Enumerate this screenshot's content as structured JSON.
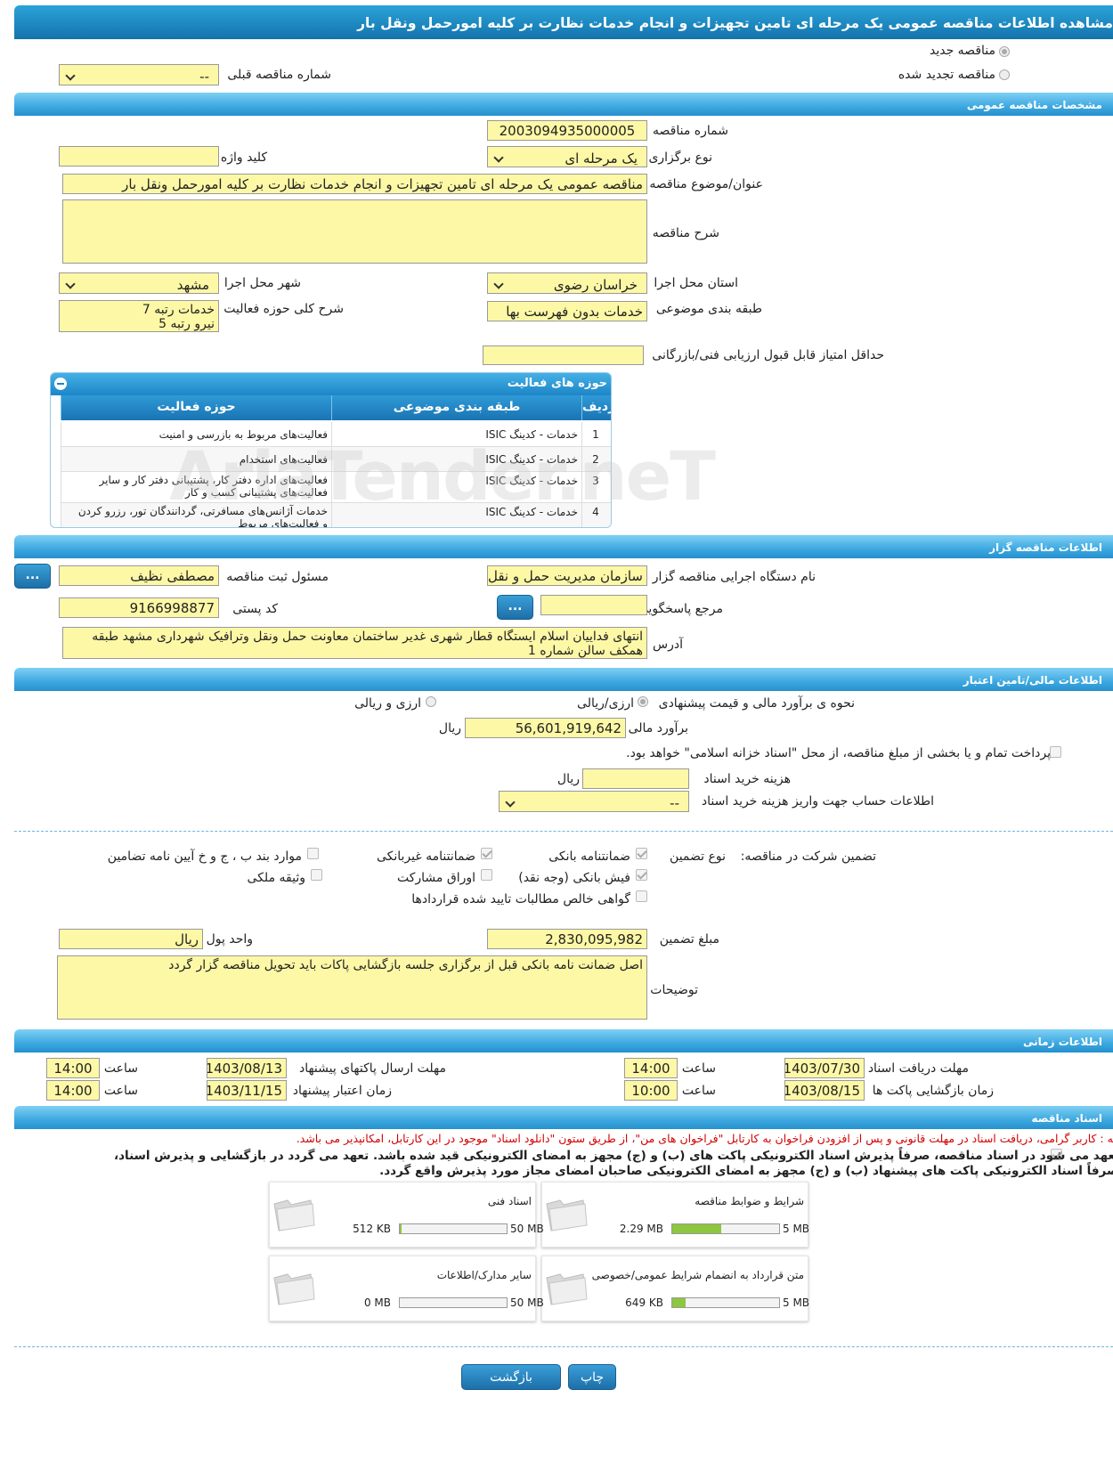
{
  "title": "مشاهده اطلاعات مناقصه عمومی یک مرحله ای تامین تجهیزات و انجام خدمات نظارت بر کلیه امورحمل ونقل بار",
  "top": {
    "new_tender": "مناقصه جدید",
    "renewed_tender": "مناقصه تجدید شده",
    "prev_number_label": "شماره مناقصه قبلی",
    "prev_number_value": "--"
  },
  "sections": {
    "general": "مشخصات مناقصه عمومی",
    "organizer": "اطلاعات مناقصه گزار",
    "financial": "اطلاعات مالی/تامین اعتبار",
    "time": "اطلاعات زمانی",
    "docs": "اسناد مناقصه"
  },
  "general": {
    "number_label": "شماره مناقصه",
    "number_value": "2003094935000005",
    "type_label": "نوع برگزاری",
    "type_value": "یک مرحله ای",
    "keyword_label": "کلید واژه",
    "keyword_value": "",
    "subject_label": "عنوان/موضوع مناقصه",
    "subject_value": "مناقصه عمومی یک مرحله ای تامین تجهیزات و انجام خدمات نظارت بر کلیه امورحمل ونقل بار",
    "desc_label": "شرح مناقصه",
    "desc_value": "",
    "province_label": "استان محل اجرا",
    "province_value": "خراسان رضوی",
    "city_label": "شهر محل اجرا",
    "city_value": "مشهد",
    "category_label": "طبقه بندی موضوعی",
    "category_value": "خدمات بدون فهرست بها",
    "scope_label": "شرح کلی حوزه فعالیت",
    "scope_line1": "خدمات رتبه 7",
    "scope_line2": "نیرو رتبه 5",
    "min_score_label": "حداقل امتیاز قابل قبول ارزیابی فنی/بازرگانی",
    "min_score_value": ""
  },
  "activities": {
    "title": "حوزه های فعالیت",
    "headers": [
      "ردیف",
      "طبقه بندی موضوعی",
      "حوزه فعالیت"
    ],
    "rows": [
      {
        "n": "1",
        "cat": "خدمات - کدینگ ISIC",
        "a1": "فعالیت‌های مربوط به بازرسی و امنیت",
        "a2": ""
      },
      {
        "n": "2",
        "cat": "خدمات - کدینگ ISIC",
        "a1": "فعالیت‌های استخدام",
        "a2": ""
      },
      {
        "n": "3",
        "cat": "خدمات - کدینگ ISIC",
        "a1": "فعالیت‌های  اداره دفتر کار، پشتیبانی دفتر کار و سایر",
        "a2": "فعالیت‌های پشتیبانی کسب و کار"
      },
      {
        "n": "4",
        "cat": "خدمات - کدینگ ISIC",
        "a1": "خدمات آژانس‌های مسافرتی، گردانندگان تور، رزرو کردن",
        "a2": "و فعالیت‌های مربوط"
      }
    ]
  },
  "watermark": "AriaTender.neT",
  "organizer": {
    "org_label": "نام دستگاه اجرایی مناقصه گزار",
    "org_value": "سازمان مدیریت حمل و نقل",
    "resp_label": "مسئول ثبت مناقصه",
    "resp_value": "مصطفی نظیف",
    "ref_label": "مرجع پاسخگویی",
    "ref_value": "",
    "postal_label": "کد پستی",
    "postal_value": "9166998877",
    "addr_label": "آدرس",
    "addr_line1": "انتهای فداییان اسلام ایستگاه قطار شهری غدیر ساختمان معاونت حمل ونقل وترافیک شهرداری مشهد طبقه",
    "addr_line2": "همکف سالن شماره 1",
    "dots": "..."
  },
  "financial": {
    "method_label": "نحوه ی برآورد مالی و قیمت پیشنهادی",
    "opt_rial": "ارزی/ریالی",
    "opt_fx": "ارزی و ریالی",
    "estimate_label": "برآورد مالی",
    "estimate_value": "56,601,919,642",
    "rial": "ریال",
    "treasury_text": "پرداخت تمام و یا بخشی از مبلغ مناقصه، از محل \"اسناد خزانه اسلامی\" خواهد بود.",
    "doc_cost_label": "هزینه خرید اسناد",
    "doc_cost_value": "",
    "account_label": "اطلاعات حساب جهت واریز هزینه خرید اسناد",
    "account_value": "--"
  },
  "guarantee": {
    "label": "تضمین شرکت در مناقصه:",
    "type_label": "نوع تضمین",
    "bank_guarantee": "ضمانتنامه بانکی",
    "nonbank_guarantee": "ضمانتنامه غیربانکی",
    "regulation": "موارد بند ب ، ج و خ آیین نامه تضامین",
    "cash_slip": "فیش بانکی (وجه نقد)",
    "bonds": "اوراق مشارکت",
    "property": "وثیقه ملکی",
    "receivables": "گواهی خالص مطالبات تایید شده قراردادها",
    "amount_label": "مبلغ تضمین",
    "amount_value": "2,830,095,982",
    "currency_label": "واحد پول",
    "currency_value": "ریال",
    "notes_label": "توضیحات",
    "notes_value": "اصل ضمانت نامه بانکی قبل از برگزاری جلسه بازگشایی پاکات باید تحویل مناقصه گزار گردد"
  },
  "time": {
    "receive_label": "مهلت دریافت اسناد",
    "receive_date": "1403/07/30",
    "receive_time": "14:00",
    "submit_label": "مهلت ارسال پاکتهای پیشنهاد",
    "submit_date": "1403/08/13",
    "submit_time": "14:00",
    "open_label": "زمان بازگشایی پاکت ها",
    "open_date": "1403/08/15",
    "open_time": "10:00",
    "valid_label": "زمان اعتبار پیشنهاد",
    "valid_date": "1403/11/15",
    "valid_time": "14:00",
    "hour": "ساعت"
  },
  "docs": {
    "notice": "توجه : کاربر گرامی، دریافت اسناد در مهلت قانونی و پس از افزودن فراخوان به کارتابل \"فراخوان های من\"، از طریق ستون \"دانلود اسناد\" موجود در این کارتابل، امکانپذیر می باشد.",
    "pledge1": "متعهد می شود در اسناد مناقصه، صرفاً پذیرش اسناد الکترونیکی پاکت های (ب) و (ج) مجهز به امضای الکترونیکی قید شده باشد. تعهد می گردد در بازگشایی و پذیرش اسناد،",
    "pledge2": "صرفاً اسناد الکترونیکی پاکت های پیشنهاد (ب) و (ج) مجهز به امضای الکترونیکی صاحبان امضای مجاز مورد پذیرش واقع گردد.",
    "files": [
      {
        "name": "شرایط و ضوابط مناقصه",
        "size": "2.29 MB",
        "max": "5 MB",
        "fill": 0.458
      },
      {
        "name": "اسناد فنی",
        "size": "512 KB",
        "max": "50 MB",
        "fill": 0.01
      },
      {
        "name": "متن قرارداد به انضمام شرایط عمومی/خصوصی",
        "size": "649 KB",
        "max": "5 MB",
        "fill": 0.127
      },
      {
        "name": "سایر مدارک/اطلاعات",
        "size": "0 MB",
        "max": "50 MB",
        "fill": 0
      }
    ]
  },
  "buttons": {
    "print": "چاپ",
    "back": "بازگشت"
  }
}
